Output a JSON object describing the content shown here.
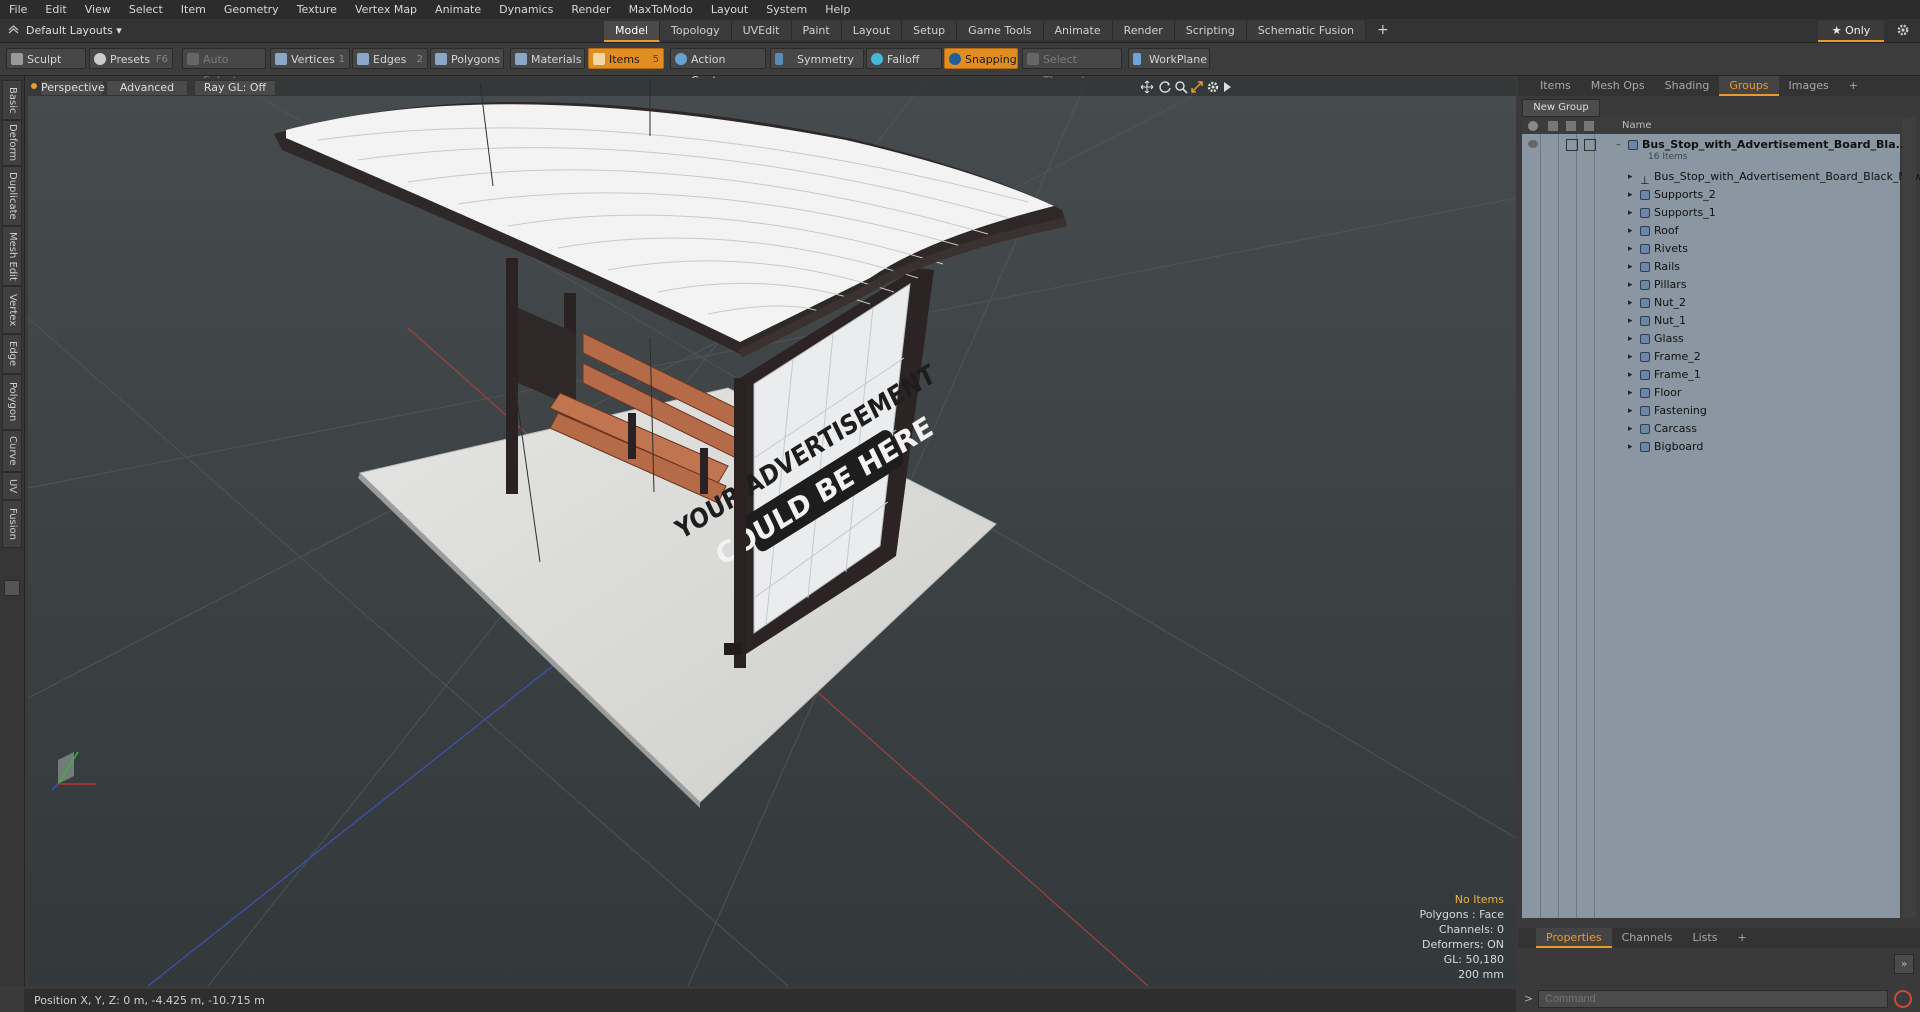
{
  "menu": [
    "File",
    "Edit",
    "View",
    "Select",
    "Item",
    "Geometry",
    "Texture",
    "Vertex Map",
    "Animate",
    "Dynamics",
    "Render",
    "MaxToModo",
    "Layout",
    "System",
    "Help"
  ],
  "layout": {
    "selector": "Default Layouts ▾",
    "tabs": [
      "Model",
      "Topology",
      "UVEdit",
      "Paint",
      "Layout",
      "Setup",
      "Game Tools",
      "Animate",
      "Render",
      "Scripting",
      "Schematic Fusion"
    ],
    "active_tab": "Model",
    "add": "+",
    "only": "★ Only"
  },
  "toolbar": {
    "sculpt": "Sculpt",
    "presets": "Presets",
    "presets_key": "F6",
    "auto_select": "Auto Select",
    "vertices": "Vertices",
    "vertices_count": "1",
    "edges": "Edges",
    "edges_count": "2",
    "polygons": "Polygons",
    "materials": "Materials",
    "items": "Items",
    "items_count": "5",
    "action_center": "Action Center",
    "symmetry": "Symmetry",
    "falloff": "Falloff",
    "snapping": "Snapping",
    "select_through": "Select Through",
    "workplane": "WorkPlane"
  },
  "left_tabs": [
    "Basic",
    "Deform",
    "Duplicate",
    "Mesh Edit",
    "Vertex",
    "Edge",
    "Polygon",
    "Curve",
    "UV",
    "Fusion"
  ],
  "viewport": {
    "view": "Perspective",
    "shading": "Advanced",
    "raygl": "Ray GL: Off",
    "stats": {
      "items": "No Items",
      "polygons": "Polygons : Face",
      "channels": "Channels: 0",
      "deformers": "Deformers: ON",
      "gl": "GL: 50,180",
      "scale": "200 mm"
    },
    "billboard_line1": "YOUR ADVERTISEMENT",
    "billboard_line2": "COULD BE HERE"
  },
  "status": {
    "position": "Position X, Y, Z:  0 m, -4.425 m, -10.715 m"
  },
  "panel": {
    "tabs": [
      "Items",
      "Mesh Ops",
      "Shading",
      "Groups",
      "Images",
      "+"
    ],
    "active_tab": "Groups",
    "new_group": "New Group",
    "name_header": "Name",
    "root": "Bus_Stop_with_Advertisement_Board_Bla...",
    "root_count": "16 Items",
    "children": [
      "Bus_Stop_with_Advertisement_Board_Black_New",
      "Supports_2",
      "Supports_1",
      "Roof",
      "Rivets",
      "Rails",
      "Pillars",
      "Nut_2",
      "Nut_1",
      "Glass",
      "Frame_2",
      "Frame_1",
      "Floor",
      "Fastening",
      "Carcass",
      "Bigboard"
    ],
    "bottom_tabs": [
      "Properties",
      "Channels",
      "Lists",
      "+"
    ],
    "bottom_active": "Properties",
    "command_placeholder": "Command"
  }
}
